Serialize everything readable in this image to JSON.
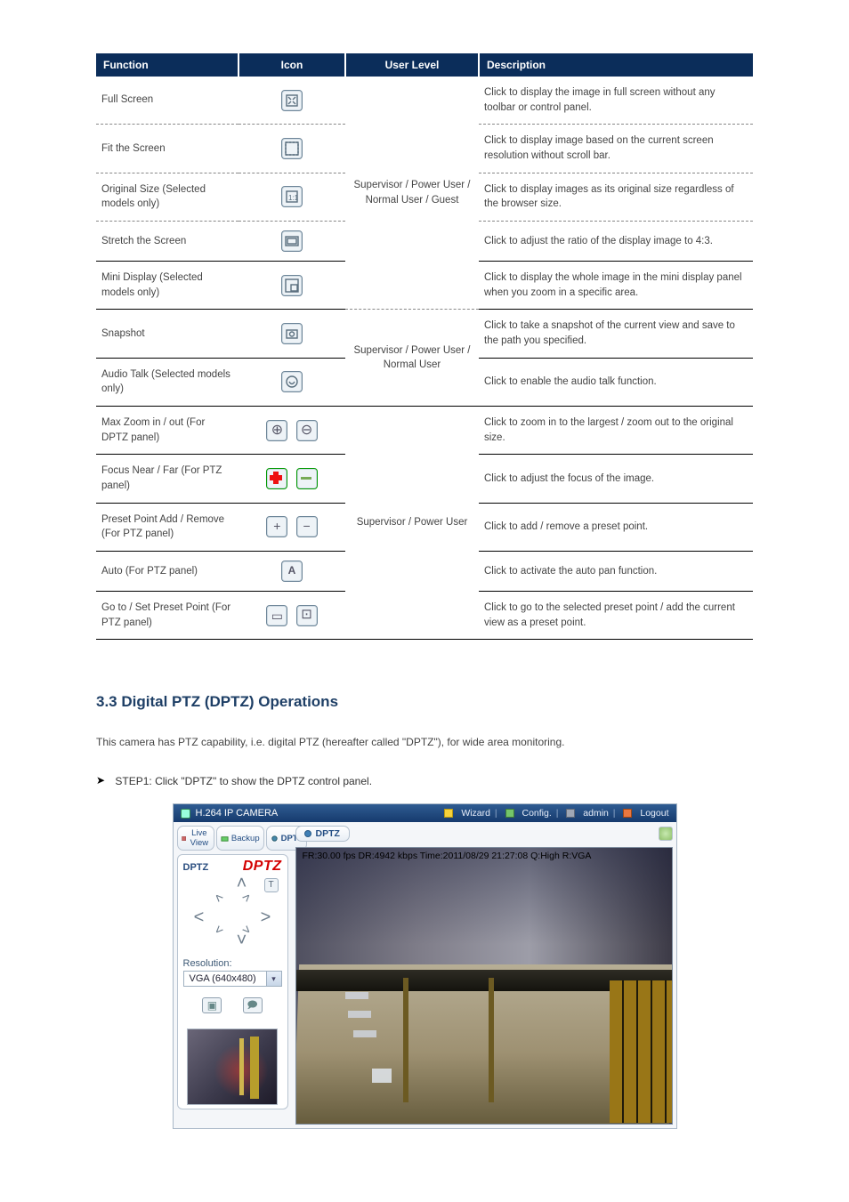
{
  "table": {
    "headers": [
      "Function",
      "Icon",
      "User Level",
      "Description"
    ],
    "rows": [
      {
        "style": "dashed",
        "name": "Full Screen",
        "icon": "fullscreen",
        "type": "Supervisor / Power User / Normal User / Guest",
        "desc": "Click to display the image in full screen without any toolbar or control panel."
      },
      {
        "style": "dashed",
        "name": "Fit the Screen",
        "icon": "fitscreen",
        "type": "",
        "desc": "Click to display image based on the current screen resolution without scroll bar."
      },
      {
        "style": "dashed",
        "name": "Original Size (Selected models only)",
        "icon": "original",
        "type": "",
        "desc": "Click to display images as its original size regardless of the browser size."
      },
      {
        "style": "solid",
        "name": "Stretch the Screen",
        "icon": "stretch",
        "type": "",
        "desc": "Click to adjust the ratio of the display image to 4:3."
      },
      {
        "style": "solid",
        "name": "Mini Display (Selected models only)",
        "icon": "mini",
        "type": "",
        "desc": "Click to display the whole image in the mini display panel when you zoom in a specific area."
      },
      {
        "style": "solid",
        "name": "Snapshot",
        "icon": "snapshot",
        "type": "Supervisor / Power User / Normal User",
        "desc": "Click to take a snapshot of the current view and save to the path you specified."
      },
      {
        "style": "solid",
        "name": "Audio Talk (Selected models only)",
        "icon": "audiotalk",
        "type": "",
        "desc": "Click to enable the audio talk function."
      },
      {
        "style": "solid",
        "name": "Max Zoom in / out (For DPTZ panel)",
        "icons": [
          "zoomin",
          "zoomout"
        ],
        "type": "",
        "desc": "Click to zoom in to the largest / zoom out to the original size."
      },
      {
        "style": "solid",
        "name": "Focus Near / Far (For PTZ panel)",
        "icons": [
          "focusnear",
          "focusfar"
        ],
        "type": "Supervisor / Power User",
        "desc": "Click to adjust the focus of the image."
      },
      {
        "style": "solid",
        "name": "Preset Point Add / Remove (For PTZ panel)",
        "icons": [
          "presetadd",
          "presetremove"
        ],
        "type": "",
        "desc": "Click to add / remove a preset point."
      },
      {
        "style": "solid",
        "name": "Auto (For PTZ panel)",
        "icon": "auto",
        "type": "",
        "desc": "Click to activate the auto pan function."
      },
      {
        "style": "solid",
        "name": "Go to / Set Preset Point (For PTZ panel)",
        "icons": [
          "goto",
          "set"
        ],
        "type": "",
        "desc": "Click to go to the selected preset point / add the current view as a preset point."
      }
    ]
  },
  "heading": "3.3 Digital PTZ (DPTZ) Operations",
  "intro": "This camera has PTZ capability, i.e. digital PTZ (hereafter called \"DPTZ\"), for wide area monitoring.",
  "bullet": "STEP1: Click \"DPTZ\" to show the DPTZ control panel.",
  "screenshot": {
    "title": "H.264 IP CAMERA",
    "toplinks": [
      "Wizard",
      "Config.",
      "admin",
      "Logout"
    ],
    "tabs": [
      "Live View",
      "Backup",
      "DPTZ"
    ],
    "activeTab": 2,
    "panel": {
      "smallLabel": "DPTZ",
      "bigLabel": "DPTZ",
      "cornerBtn": "T",
      "resLabel": "Resolution:",
      "resValue": "VGA (640x480)"
    },
    "chip": "DPTZ",
    "overlay": "FR:30.00 fps DR:4942 kbps Time:2011/08/29 21:27:08 Q:High R:VGA"
  }
}
